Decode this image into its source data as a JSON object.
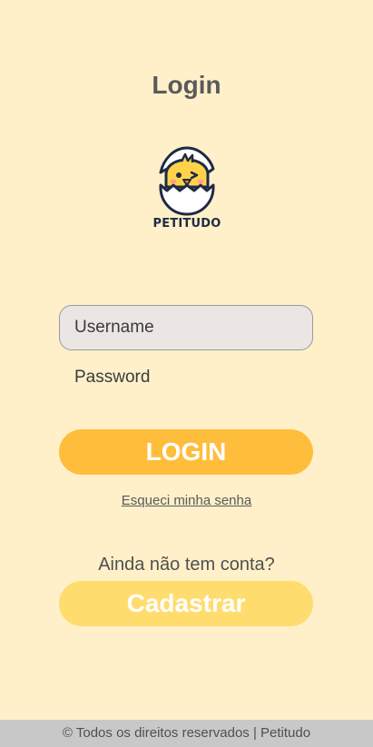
{
  "page": {
    "title": "Login"
  },
  "logo": {
    "icon": "chick-in-egg-icon",
    "text": "PETITUDO"
  },
  "form": {
    "username_placeholder": "Username",
    "username_value": "",
    "password_placeholder": "Password",
    "password_value": "",
    "login_label": "LOGIN",
    "forgot_label": "Esqueci minha senha"
  },
  "register": {
    "prompt": "Ainda não tem conta?",
    "button_label": "Cadastrar"
  },
  "footer": {
    "text": "© Todos os direitos reservados | Petitudo"
  },
  "colors": {
    "background": "#fff0c9",
    "login_button": "#ffbd3c",
    "register_button": "#ffdc6e",
    "input_background": "#ebe6e4",
    "footer_background": "#c8c8c8"
  }
}
